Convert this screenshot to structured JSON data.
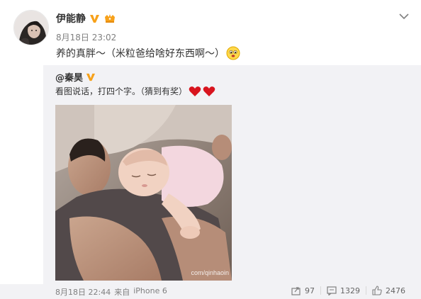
{
  "post": {
    "user_name": "伊能静",
    "time": "8月18日 23:02",
    "text": "养的真胖～（米粒爸给啥好东西啊～）"
  },
  "repost": {
    "user_name": "@秦昊",
    "text": "看图说话，打四个字。（猜到有奖）",
    "image_watermark": "com/qinhaoin",
    "time": "8月18日 22:44",
    "source_prefix": "来自",
    "source": "iPhone 6",
    "forward_count": "97",
    "comment_count": "1329",
    "like_count": "2476"
  },
  "icons": {
    "verify": "verified-v-icon",
    "vip": "vip-crown-icon",
    "emoji": "drooling-face-emoji",
    "heart": "red-heart-icon",
    "more": "chevron-down-icon",
    "forward": "forward-icon",
    "comment": "comment-icon",
    "like": "thumbs-up-icon"
  },
  "colors": {
    "verify_orange": "#f7a11a",
    "repost_bg": "#f2f2f5",
    "heart_red": "#d8141e",
    "text_gray": "#808080"
  }
}
